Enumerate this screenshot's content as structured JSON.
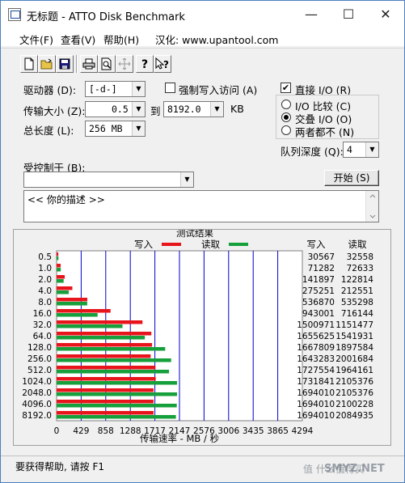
{
  "window": {
    "title": "无标题 - ATTO Disk Benchmark",
    "minimize_glyph": "—",
    "maximize_glyph": "☐",
    "close_glyph": "✕"
  },
  "menu": {
    "items": [
      "文件(F)",
      "查看(V)",
      "帮助(H)",
      "汉化: www.upantool.com"
    ]
  },
  "toolbar": {
    "icons": [
      "new-file-icon",
      "open-folder-icon",
      "save-icon",
      "print-icon",
      "print-preview-icon",
      "move-icon",
      "help-icon",
      "context-help-icon"
    ]
  },
  "settings": {
    "drive_label": "驱动器 (D):",
    "drive_value": "[-d-]",
    "transfer_label": "传输大小 (Z):",
    "transfer_from": "0.5",
    "to_label": "到",
    "transfer_to": "8192.0",
    "kb_label": "KB",
    "total_label": "总长度 (L):",
    "total_value": "256 MB",
    "force_write_label": "强制写入访问 (A)",
    "direct_io_label": "直接 I/O (R)",
    "direct_io_checked": true,
    "io_compare_label": "I/O 比较 (C)",
    "overlap_label": "交叠 I/O (O)",
    "neither_label": "两者都不 (N)",
    "selected_mode": "overlap",
    "queue_depth_label": "队列深度 (Q):",
    "queue_depth_value": "4",
    "controlled_by_label": "受控制于 (B):",
    "controlled_by_value": "",
    "start_button": "开始 (S)",
    "description_text": "<<  你的描述    >>"
  },
  "results": {
    "title": "测试结果",
    "legend_write": "写入",
    "legend_read": "读取",
    "col_write": "写入",
    "col_read": "读取",
    "rows": [
      {
        "size": "0.5",
        "write": "30567",
        "read": "32558"
      },
      {
        "size": "1.0",
        "write": "71282",
        "read": "72633"
      },
      {
        "size": "2.0",
        "write": "141897",
        "read": "122814"
      },
      {
        "size": "4.0",
        "write": "275251",
        "read": "212551"
      },
      {
        "size": "8.0",
        "write": "536870",
        "read": "535298"
      },
      {
        "size": "16.0",
        "write": "943001",
        "read": "716144"
      },
      {
        "size": "32.0",
        "write": "1500971",
        "read": "1151477"
      },
      {
        "size": "64.0",
        "write": "1655625",
        "read": "1541931"
      },
      {
        "size": "128.0",
        "write": "1667809",
        "read": "1897584"
      },
      {
        "size": "256.0",
        "write": "1643283",
        "read": "2001684"
      },
      {
        "size": "512.0",
        "write": "1727554",
        "read": "1964161"
      },
      {
        "size": "1024.0",
        "write": "1731841",
        "read": "2105376"
      },
      {
        "size": "2048.0",
        "write": "1694010",
        "read": "2105376"
      },
      {
        "size": "4096.0",
        "write": "1694010",
        "read": "2100228"
      },
      {
        "size": "8192.0",
        "write": "1694010",
        "read": "2084935"
      }
    ]
  },
  "chart_data": {
    "type": "bar",
    "title": "测试结果",
    "xlabel": "传输速率 - MB / 秒",
    "ylabel": "",
    "categories": [
      "0.5",
      "1.0",
      "2.0",
      "4.0",
      "8.0",
      "16.0",
      "32.0",
      "64.0",
      "128.0",
      "256.0",
      "512.0",
      "1024.0",
      "2048.0",
      "4096.0",
      "8192.0"
    ],
    "series": [
      {
        "name": "写入",
        "color": "#e8141b",
        "values": [
          30.567,
          71.282,
          141.897,
          275.251,
          536.87,
          943.001,
          1500.971,
          1655.625,
          1667.809,
          1643.283,
          1727.554,
          1731.841,
          1694.01,
          1694.01,
          1694.01
        ]
      },
      {
        "name": "读取",
        "color": "#15a03b",
        "values": [
          32.558,
          72.633,
          122.814,
          212.551,
          535.298,
          716.144,
          1151.477,
          1541.931,
          1897.584,
          2001.684,
          1964.161,
          2105.376,
          2105.376,
          2100.228,
          2084.935
        ]
      }
    ],
    "xticks": [
      "0",
      "429",
      "858",
      "1288",
      "1717",
      "2147",
      "2576",
      "3006",
      "3435",
      "3865",
      "4294"
    ],
    "xlim": [
      0,
      4294
    ],
    "orientation": "horizontal",
    "grid": true,
    "grid_color": "#0000cc"
  },
  "status": {
    "text": "要获得帮助, 请按 F1"
  },
  "watermark": {
    "text": "值 什么值得买",
    "brand": "SMYZ.NET"
  }
}
